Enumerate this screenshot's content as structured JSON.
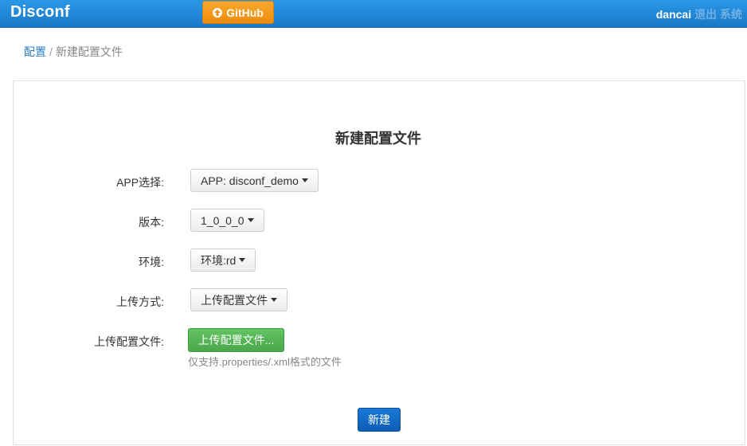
{
  "header": {
    "brand": "Disconf",
    "github_label": "GitHub",
    "user_name": "dancai",
    "user_extra": "退出 系统"
  },
  "breadcrumb": {
    "root": "配置",
    "separator": "/",
    "current": "新建配置文件"
  },
  "form": {
    "title": "新建配置文件",
    "app": {
      "label": "APP选择:",
      "value": "APP: disconf_demo"
    },
    "version": {
      "label": "版本:",
      "value": "1_0_0_0"
    },
    "env": {
      "label": "环境:",
      "value": "环境:rd"
    },
    "upload_method": {
      "label": "上传方式:",
      "value": "上传配置文件"
    },
    "upload_file": {
      "label": "上传配置文件:",
      "button": "上传配置文件...",
      "help": "仅支持.properties/.xml格式的文件"
    },
    "submit": "新建"
  },
  "colors": {
    "topbar": "#1a78c8",
    "github": "#ef8d0b",
    "upload": "#4aa84a",
    "submit": "#0d5cb6",
    "link": "#2a7fc4"
  }
}
